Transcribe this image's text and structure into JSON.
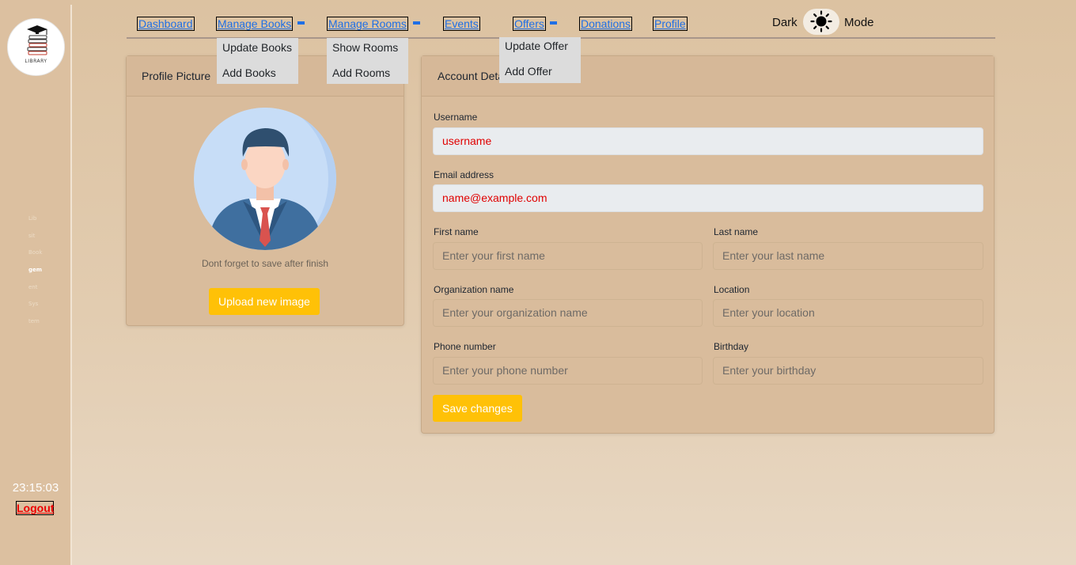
{
  "sidebar": {
    "logo_text": "LIBRARY",
    "tiny_items": [
      "Lib",
      "sit",
      "Book",
      "gem",
      "ent",
      "Sys",
      "tem"
    ],
    "active_index": 3,
    "clock": "23:15:03",
    "logout_label": "Logout"
  },
  "nav": {
    "links": [
      "Dashboard",
      "Manage Books",
      "Manage Rooms",
      "Events",
      "Offers",
      "Donations",
      "Profile"
    ],
    "books_menu": [
      "Update Books",
      "Add Books"
    ],
    "rooms_menu": [
      "Show Rooms",
      "Add Rooms"
    ],
    "offers_menu": [
      "Update Offer",
      "Add Offer"
    ],
    "mode_dark": "Dark",
    "mode_label": "Mode"
  },
  "profile_card": {
    "title": "Profile Picture",
    "hint": "Dont forget to save after finish",
    "upload_label": "Upload new image"
  },
  "account_card": {
    "title": "Account Details",
    "username_label": "Username",
    "username_value": "username",
    "email_label": "Email address",
    "email_value": "name@example.com",
    "first_label": "First name",
    "first_placeholder": "Enter your first name",
    "last_label": "Last name",
    "last_placeholder": "Enter your last name",
    "org_label": "Organization name",
    "org_placeholder": "Enter your organization name",
    "location_label": "Location",
    "location_placeholder": "Enter your location",
    "phone_label": "Phone number",
    "phone_placeholder": "Enter your phone number",
    "birthday_label": "Birthday",
    "birthday_placeholder": "Enter your birthday",
    "save_label": "Save changes"
  },
  "colors": {
    "accent": "#ffc107",
    "link": "#1f6fe5",
    "filled_text": "#e00000"
  }
}
